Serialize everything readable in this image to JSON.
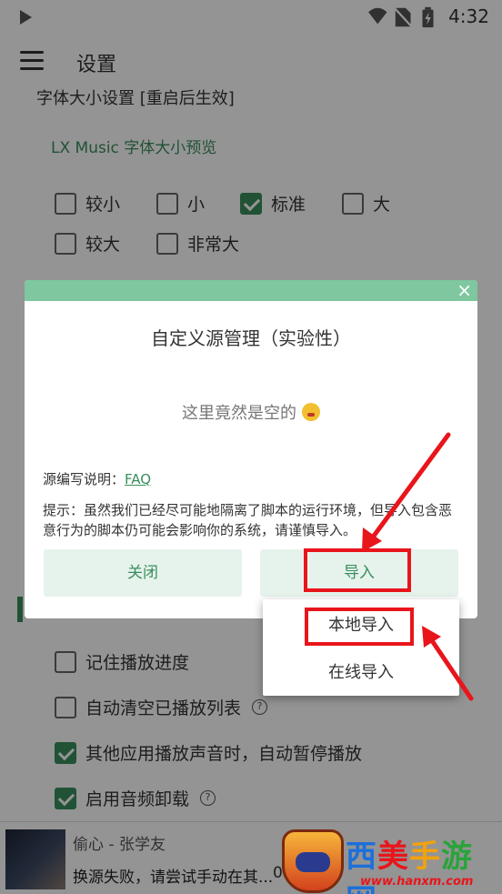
{
  "status_bar": {
    "time": "4:32"
  },
  "app_bar": {
    "title": "设置"
  },
  "settings": {
    "font_size_heading": "字体大小设置 [重启后生效]",
    "preview_text": "LX Music 字体大小预览",
    "font_sizes": [
      {
        "label": "较小",
        "checked": false
      },
      {
        "label": "小",
        "checked": false
      },
      {
        "label": "标准",
        "checked": true
      },
      {
        "label": "大",
        "checked": false
      },
      {
        "label": "较大",
        "checked": false
      },
      {
        "label": "非常大",
        "checked": false
      }
    ],
    "playback_options": [
      {
        "label": "记住播放进度",
        "checked": false,
        "help": false
      },
      {
        "label": "自动清空已播放列表",
        "checked": false,
        "help": true
      },
      {
        "label": "其他应用播放声音时，自动暂停播放",
        "checked": true,
        "help": false
      },
      {
        "label": "启用音频卸载",
        "checked": true,
        "help": true
      }
    ]
  },
  "dialog": {
    "title": "自定义源管理（实验性）",
    "empty_text": "这里竟然是空的",
    "faq_label": "源编写说明：",
    "faq_link": "FAQ",
    "tip": "提示：虽然我们已经尽可能地隔离了脚本的运行环境，但导入包含恶意行为的脚本仍可能会影响你的系统，请谨慎导入。",
    "close_button": "关闭",
    "import_button": "导入",
    "close_icon": "×"
  },
  "import_menu": {
    "local": "本地导入",
    "online": "在线导入"
  },
  "player": {
    "song": "偷心 - 张学友",
    "status": "换源失败，请尝试手动在其...",
    "time": "00:00"
  },
  "watermark": {
    "text": "西美手游网",
    "url": "www.hanxm.com"
  },
  "colors": {
    "accent": "#3a8e5e",
    "dialog_header": "#7fc79f",
    "highlight": "#e8151b"
  }
}
